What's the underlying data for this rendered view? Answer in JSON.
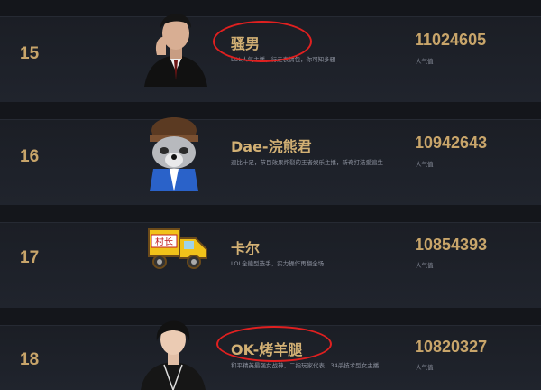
{
  "rows": [
    {
      "rank": "15",
      "name": "骚男",
      "desc": "LOL人气主播，行走表情包，你可知多骚",
      "score": "11024605",
      "score_label": "人气值",
      "avatar_icon": "man-in-suit-avatar"
    },
    {
      "rank": "16",
      "name": "Dae-浣熊君",
      "desc": "逗比十足，节目效果炸裂的王者娱乐主播，新奇打法爱追生",
      "score": "10942643",
      "score_label": "人气值",
      "avatar_icon": "raccoon-avatar"
    },
    {
      "rank": "17",
      "name": "卡尔",
      "desc": "LOL全能型选手，实力操作再翻全场",
      "score": "10854393",
      "score_label": "人气值",
      "avatar_icon": "village-chief-truck-avatar"
    },
    {
      "rank": "18",
      "name": "OK-烤羊腿",
      "desc": "和平精英最强女战神，二指玩家代表，34杀技术型女主播",
      "score": "10820327",
      "score_label": "人气值",
      "avatar_icon": "girl-avatar"
    }
  ],
  "truck_sign": "村长",
  "colors": {
    "accent": "#c8a56a",
    "background": "#1c1f26",
    "circle": "#e02020"
  }
}
